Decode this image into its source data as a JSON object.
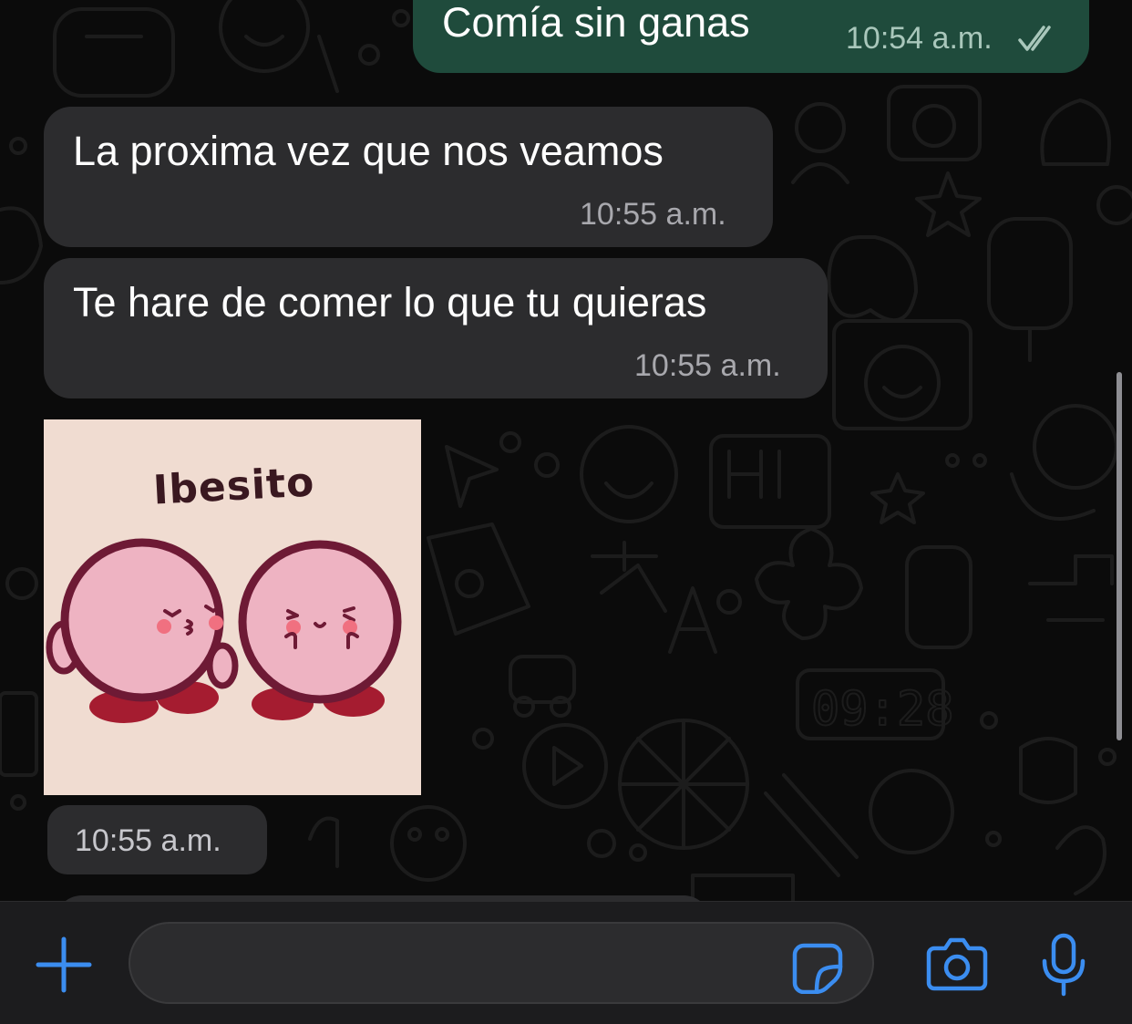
{
  "messages": [
    {
      "id": "m1",
      "direction": "outgoing",
      "text": "Comía sin ganas",
      "time": "10:54 a.m.",
      "status": "read"
    },
    {
      "id": "m2",
      "direction": "incoming",
      "text": "La proxima vez que nos veamos",
      "time": "10:55 a.m."
    },
    {
      "id": "m3",
      "direction": "incoming",
      "text": "Te hare de comer lo que tu quieras",
      "time": "10:55 a.m."
    },
    {
      "id": "m4",
      "direction": "incoming",
      "type": "sticker",
      "caption": "Ibesito",
      "time": "10:55 a.m."
    }
  ],
  "composer": {
    "placeholder": "",
    "icons": [
      "plus-icon",
      "sticker-icon",
      "camera-icon",
      "microphone-icon"
    ]
  },
  "colors": {
    "accent": "#3b8df0",
    "outgoing_bubble": "#1f4b3c",
    "incoming_bubble": "#2c2c2e",
    "background": "#0b0b0b",
    "sticker_background": "#f0dcd1",
    "sticker_character": "#eeb3c2",
    "sticker_outline": "#6e1a35",
    "sticker_feet": "#a51c30",
    "sticker_cheek": "#f07080"
  }
}
